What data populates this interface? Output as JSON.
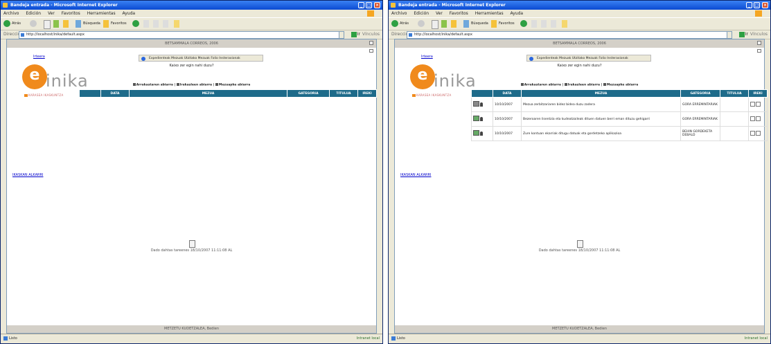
{
  "browser": {
    "title": "Bandeja entrada - Microsoft Internet Explorer",
    "menu": [
      "Archivo",
      "Edición",
      "Ver",
      "Favoritos",
      "Herramientas",
      "Ayuda"
    ],
    "toolbar": {
      "back": "Atrás",
      "search": "Búsqueda",
      "favorites": "Favoritos"
    },
    "address_label": "Dirección",
    "address": "http://localhost/inika/default.aspx",
    "go": "Ir",
    "links": "Vínculos",
    "status_left": "Listo",
    "status_right": "Intranet local"
  },
  "app": {
    "header": "BETSAMMALA CORREOS, 2006",
    "exit_link": "Irteera",
    "logo_mark": "e",
    "logo_text": "inika",
    "logo_sub": "KARASEA IKASKUNTZA",
    "send_bar": "Expedienteak  Mezuak  Utzitako Mezuak  Folio Insteraxionak",
    "question": "Kaixo zer egin nahi duzu?",
    "filters": [
      "Arrakastaren abiarra",
      "Irakasleen abiarra",
      "Mezuapke abiarra"
    ],
    "side_link": "IKASKAN ALKARRI",
    "columns": [
      "DATA",
      "MEZUA",
      "GATEGORIA",
      "TITULUA",
      "IREKI"
    ],
    "footer_note": "Dado dahtas tareenes 18/10/2007 11:11:08 AL",
    "bottom_bar": "METZETU KUDETZALEA, Bedien"
  },
  "messages": [
    {
      "icon": "envelope-unread",
      "date": "10/10/2007",
      "text": "Mezua zerbitzariaren bidez bidea duzu zadera",
      "category": "GORA ERREMINTARIAK"
    },
    {
      "icon": "envelope-read",
      "date": "10/10/2007",
      "text": "Bezeroaren lisentzia eta kudeatzaileak dituen datuen berri eman dituzu gehigarri",
      "category": "GORA ERREMINTARIAK"
    },
    {
      "icon": "envelope-read",
      "date": "10/10/2007",
      "text": "Zure kontuan ekarriak ditugu datuak eta gordetzeko aplikazioa",
      "category": "BEHIN GORDEKETA DEBALD"
    }
  ],
  "colors": {
    "table_header": "#1e6b8a",
    "logo_orange": "#f08a1c",
    "title_bar": "#0a4ad2"
  }
}
